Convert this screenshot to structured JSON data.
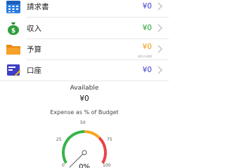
{
  "rows": [
    {
      "label": "請求書",
      "amount": "¥0",
      "amount_color": "#3a3acd",
      "icon": "calendar-icon"
    },
    {
      "label": "収入",
      "amount": "¥0",
      "amount_color": "#22a32f",
      "icon": "money-bag-icon"
    },
    {
      "label": "予算",
      "amount": "¥0",
      "amount_color": "#ef9a14",
      "icon": "folder-icon",
      "sub": "現在の周期"
    },
    {
      "label": "口座",
      "amount": "¥0",
      "amount_color": "#3a3acd",
      "icon": "account-icon"
    }
  ],
  "available": {
    "label": "Available",
    "value": "¥0"
  },
  "gauge": {
    "title": "Expense as % of Budget",
    "ticks": {
      "t0": "0",
      "t25": "25",
      "t50": "50",
      "t75": "75",
      "t100": "100"
    },
    "value_percent": 0,
    "value_text": "0%",
    "colors": {
      "green": "#37b34a",
      "orange": "#f5a623",
      "red": "#e8434a"
    }
  }
}
